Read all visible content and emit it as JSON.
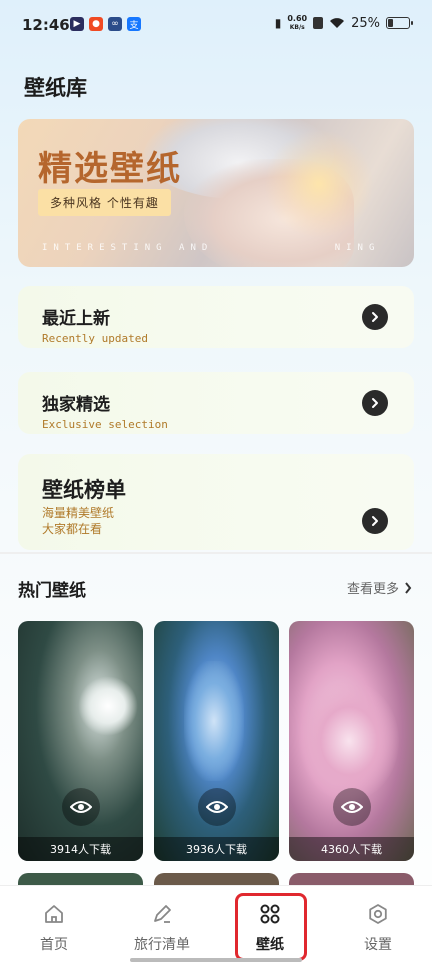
{
  "status_bar": {
    "time": "12:46",
    "net_speed_value": "0.60",
    "net_speed_unit": "KB/s",
    "battery": "25%",
    "battery_level": 0.25
  },
  "page": {
    "title": "壁纸库"
  },
  "banner": {
    "title": "精选壁纸",
    "tag": "多种风格 个性有趣",
    "tagline": "INTERESTING AND",
    "tagline2": "NING"
  },
  "menu": [
    {
      "title": "最近上新",
      "subtitle": "Recently updated"
    },
    {
      "title": "独家精选",
      "subtitle": "Exclusive selection"
    },
    {
      "title": "壁纸榜单",
      "subtitle_line1": "海量精美壁纸",
      "subtitle_line2": "大家都在看"
    }
  ],
  "hot": {
    "title": "热门壁纸",
    "see_more": "查看更多",
    "items": [
      {
        "downloads": "3914人下载"
      },
      {
        "downloads": "3936人下载"
      },
      {
        "downloads": "4360人下载"
      }
    ]
  },
  "nav": {
    "items": [
      {
        "label": "首页",
        "icon": "home-icon"
      },
      {
        "label": "旅行清单",
        "icon": "edit-icon"
      },
      {
        "label": "壁纸",
        "icon": "grid-icon"
      },
      {
        "label": "设置",
        "icon": "settings-icon"
      }
    ],
    "active": "壁纸"
  },
  "colors": {
    "accent_brown": "#b5662d",
    "subtitle_gold": "#b07a2a",
    "highlight_red": "#e0282e"
  }
}
